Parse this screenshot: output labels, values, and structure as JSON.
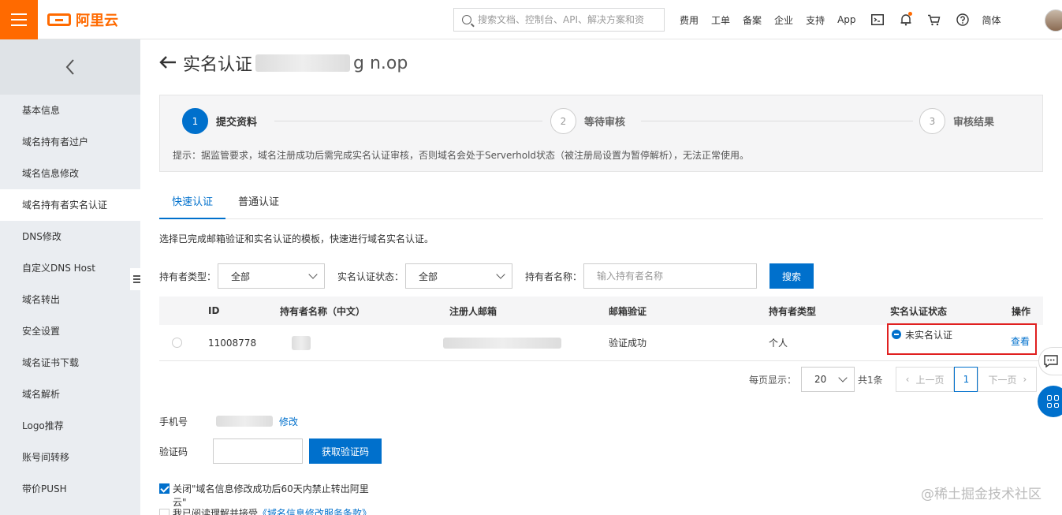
{
  "header": {
    "logo_text": "阿里云",
    "search_placeholder": "搜索文档、控制台、API、解决方案和资",
    "nav": [
      "费用",
      "工单",
      "备案",
      "企业",
      "支持",
      "App"
    ],
    "lang": "简体"
  },
  "sidebar": {
    "items": [
      {
        "label": "基本信息",
        "active": false
      },
      {
        "label": "域名持有者过户",
        "active": false
      },
      {
        "label": "域名信息修改",
        "active": false
      },
      {
        "label": "域名持有者实名认证",
        "active": true
      },
      {
        "label": "DNS修改",
        "active": false
      },
      {
        "label": "自定义DNS Host",
        "active": false
      },
      {
        "label": "域名转出",
        "active": false
      },
      {
        "label": "安全设置",
        "active": false
      },
      {
        "label": "域名证书下载",
        "active": false
      },
      {
        "label": "域名解析",
        "active": false
      },
      {
        "label": "Logo推荐",
        "active": false
      },
      {
        "label": "账号间转移",
        "active": false
      },
      {
        "label": "带价PUSH",
        "active": false
      }
    ]
  },
  "page": {
    "title_prefix": "实名认证",
    "title_suffix": "g   n.op"
  },
  "steps": {
    "items": [
      {
        "num": "1",
        "label": "提交资料",
        "active": true
      },
      {
        "num": "2",
        "label": "等待审核",
        "active": false
      },
      {
        "num": "3",
        "label": "审核结果",
        "active": false
      }
    ],
    "tip": "提示：据监管要求，域名注册成功后需完成实名认证审核，否则域名会处于Serverhold状态（被注册局设置为暂停解析），无法正常使用。"
  },
  "tabs": [
    {
      "label": "快速认证",
      "active": true
    },
    {
      "label": "普通认证",
      "active": false
    }
  ],
  "description": "选择已完成邮箱验证和实名认证的模板，快速进行域名实名认证。",
  "filters": {
    "holder_type_label": "持有者类型：",
    "holder_type_value": "全部",
    "status_label": "实名认证状态：",
    "status_value": "全部",
    "name_label": "持有者名称：",
    "name_placeholder": "输入持有者名称",
    "search_button": "搜索"
  },
  "table": {
    "columns": [
      "ID",
      "持有者名称（中文）",
      "注册人邮箱",
      "邮箱验证",
      "持有者类型",
      "实名认证状态",
      "操作"
    ],
    "rows": [
      {
        "id": "11008778",
        "email_verify": "验证成功",
        "holder_type": "个人",
        "status": "未实名认证",
        "action": "查看"
      }
    ]
  },
  "pagination": {
    "per_page_label": "每页显示：",
    "per_page_value": "20",
    "total": "共1条",
    "prev": "上一页",
    "current": "1",
    "next": "下一页"
  },
  "form": {
    "phone_label": "手机号",
    "phone_edit": "修改",
    "code_label": "验证码",
    "get_code_button": "获取验证码",
    "close_transfer_text": "关闭\"域名信息修改成功后60天内禁止转出阿里云\"",
    "agree_text": "我已阅读理解并接受",
    "agree_link": "《域名信息修改服务条款》"
  },
  "watermark": "@稀土掘金技术社区"
}
